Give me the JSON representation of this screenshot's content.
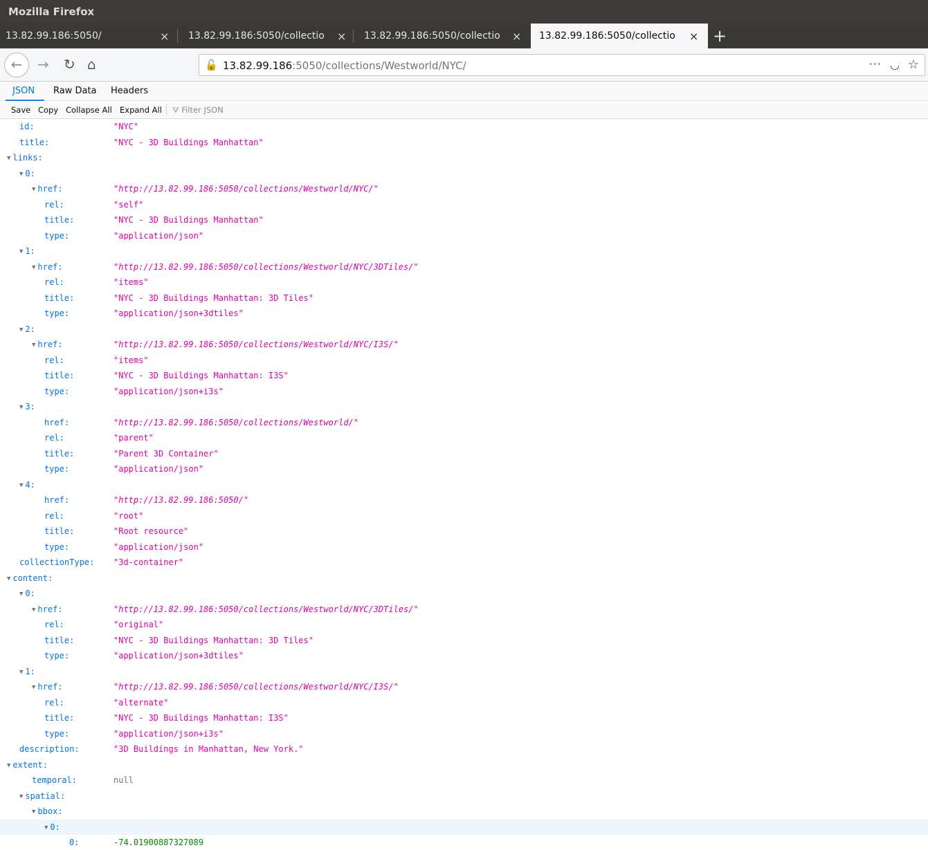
{
  "window": {
    "title": "Mozilla Firefox"
  },
  "tabs": [
    {
      "label": "13.82.99.186:5050/"
    },
    {
      "label": "13.82.99.186:5050/collectio"
    },
    {
      "label": "13.82.99.186:5050/collectio"
    },
    {
      "label": "13.82.99.186:5050/collectio",
      "active": true
    }
  ],
  "tab_close_glyph": "×",
  "newtab_glyph": "+",
  "nav": {
    "url_host": "13.82.99.186",
    "url_rest": ":5050/collections/Westworld/NYC/",
    "more_glyph": "···"
  },
  "viewer_tabs": {
    "json": "JSON",
    "raw": "Raw Data",
    "headers": "Headers"
  },
  "toolbar": {
    "save": "Save",
    "copy": "Copy",
    "collapse": "Collapse All",
    "expand": "Expand All",
    "filter_placeholder": "Filter JSON"
  },
  "json_rows": [
    {
      "k": "id:",
      "v": "\"NYC\""
    },
    {
      "k": "title:",
      "v": "\"NYC - 3D Buildings Manhattan\""
    },
    {
      "k": "links:"
    },
    {
      "k": "0:"
    },
    {
      "k": "href:",
      "v": "\"http://13.82.99.186:5050/collections/Westworld/NYC/\""
    },
    {
      "k": "rel:",
      "v": "\"self\""
    },
    {
      "k": "title:",
      "v": "\"NYC - 3D Buildings Manhattan\""
    },
    {
      "k": "type:",
      "v": "\"application/json\""
    },
    {
      "k": "1:"
    },
    {
      "k": "href:",
      "v": "\"http://13.82.99.186:5050/collections/Westworld/NYC/3DTiles/\""
    },
    {
      "k": "rel:",
      "v": "\"items\""
    },
    {
      "k": "title:",
      "v": "\"NYC - 3D Buildings Manhattan: 3D Tiles\""
    },
    {
      "k": "type:",
      "v": "\"application/json+3dtiles\""
    },
    {
      "k": "2:"
    },
    {
      "k": "href:",
      "v": "\"http://13.82.99.186:5050/collections/Westworld/NYC/I3S/\""
    },
    {
      "k": "rel:",
      "v": "\"items\""
    },
    {
      "k": "title:",
      "v": "\"NYC - 3D Buildings Manhattan: I3S\""
    },
    {
      "k": "type:",
      "v": "\"application/json+i3s\""
    },
    {
      "k": "3:"
    },
    {
      "k": "href:",
      "v": "\"http://13.82.99.186:5050/collections/Westworld/\""
    },
    {
      "k": "rel:",
      "v": "\"parent\""
    },
    {
      "k": "title:",
      "v": "\"Parent 3D Container\""
    },
    {
      "k": "type:",
      "v": "\"application/json\""
    },
    {
      "k": "4:"
    },
    {
      "k": "href:",
      "v": "\"http://13.82.99.186:5050/\""
    },
    {
      "k": "rel:",
      "v": "\"root\""
    },
    {
      "k": "title:",
      "v": "\"Root resource\""
    },
    {
      "k": "type:",
      "v": "\"application/json\""
    },
    {
      "k": "collectionType:",
      "v": "\"3d-container\""
    },
    {
      "k": "content:"
    },
    {
      "k": "0:"
    },
    {
      "k": "href:",
      "v": "\"http://13.82.99.186:5050/collections/Westworld/NYC/3DTiles/\""
    },
    {
      "k": "rel:",
      "v": "\"original\""
    },
    {
      "k": "title:",
      "v": "\"NYC - 3D Buildings Manhattan: 3D Tiles\""
    },
    {
      "k": "type:",
      "v": "\"application/json+3dtiles\""
    },
    {
      "k": "1:"
    },
    {
      "k": "href:",
      "v": "\"http://13.82.99.186:5050/collections/Westworld/NYC/I3S/\""
    },
    {
      "k": "rel:",
      "v": "\"alternate\""
    },
    {
      "k": "title:",
      "v": "\"NYC - 3D Buildings Manhattan: I3S\""
    },
    {
      "k": "type:",
      "v": "\"application/json+i3s\""
    },
    {
      "k": "description:",
      "v": "\"3D Buildings in Manhattan, New York.\""
    },
    {
      "k": "extent:"
    },
    {
      "k": "temporal:",
      "v": "null"
    },
    {
      "k": "spatial:"
    },
    {
      "k": "bbox:"
    },
    {
      "k": "0:"
    },
    {
      "k": "0:",
      "v": "-74.01900887327089"
    }
  ]
}
